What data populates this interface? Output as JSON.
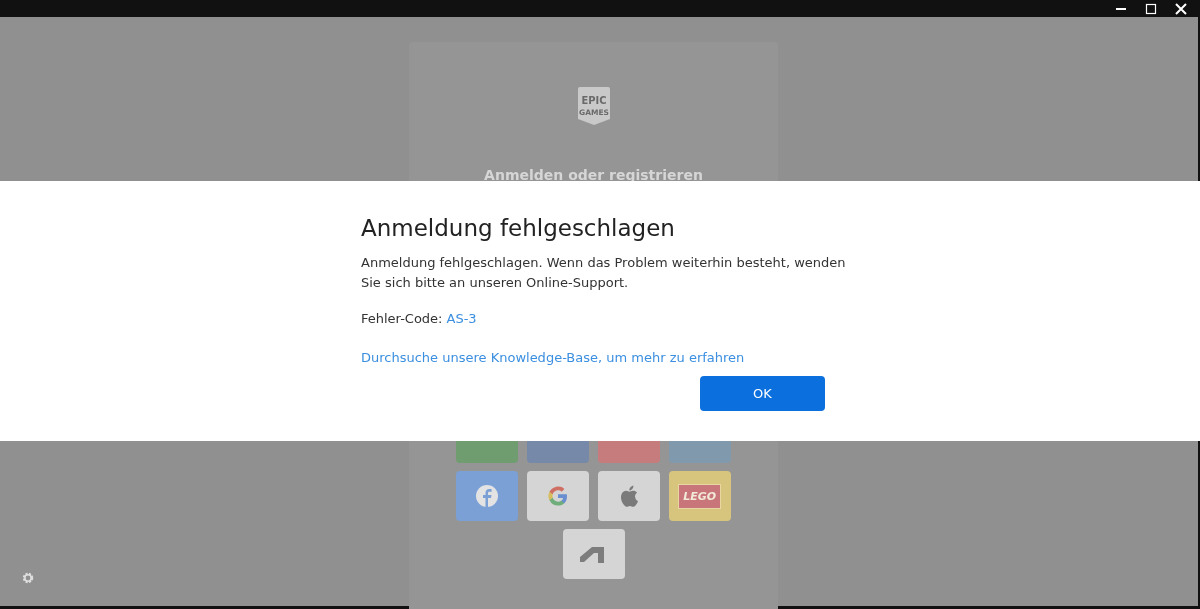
{
  "window_controls": [
    {
      "kind": "minimize"
    },
    {
      "kind": "maximize"
    },
    {
      "kind": "close"
    }
  ],
  "login_card": {
    "logo_text": [
      "EPIC",
      "GAMES"
    ],
    "heading": "Anmelden oder registrieren",
    "providers": [
      {
        "kind": "blank",
        "color": "#6f9d6f"
      },
      {
        "kind": "blank",
        "color": "#7689a8"
      },
      {
        "kind": "blank",
        "color": "#c67c7c"
      },
      {
        "kind": "blank",
        "color": "#8199ad"
      },
      {
        "kind": "facebook",
        "color": "#7ba0d6"
      },
      {
        "kind": "google",
        "color": "#d5d5d5"
      },
      {
        "kind": "apple",
        "color": "#d5d5d5"
      },
      {
        "kind": "lego",
        "color": "#d7c57d",
        "label": "LEGO"
      },
      {
        "kind": "arch",
        "color": "#d5d5d5"
      }
    ]
  },
  "dialog": {
    "title": "Anmeldung fehlgeschlagen",
    "message": "Anmeldung fehlgeschlagen. Wenn das Problem weiterhin besteht, wenden Sie sich bitte an unseren Online-Support.",
    "error_label": "Fehler-Code:",
    "error_code": "AS-3",
    "link": "Durchsuche unsere Knowledge-Base, um mehr zu erfahren",
    "button": "OK"
  }
}
